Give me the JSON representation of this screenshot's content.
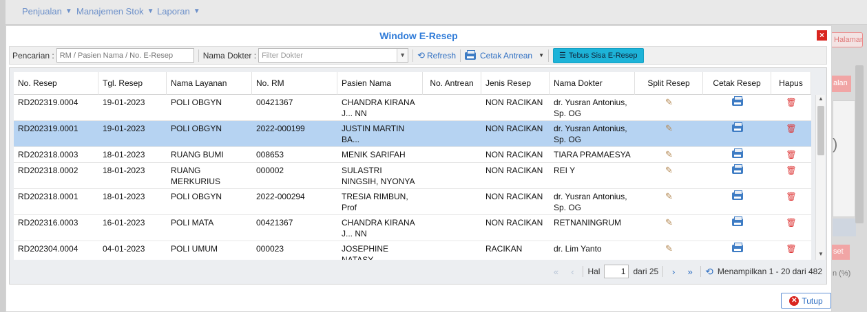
{
  "nav": {
    "items": [
      "Penjualan",
      "Manajemen Stok",
      "Laporan"
    ]
  },
  "background": {
    "halaman_label": "Halaman",
    "btn1_label": "alan",
    "btn2_label": "set",
    "npct_label": "n (%)",
    "paren": ")"
  },
  "modal": {
    "title": "Window E-Resep",
    "close_label": "×",
    "close_button_label": "Tutup"
  },
  "toolbar": {
    "search_label": "Pencarian :",
    "search_placeholder": "RM / Pasien Nama / No. E-Resep",
    "doctor_label": "Nama Dokter :",
    "doctor_placeholder": "Filter Dokter",
    "refresh_label": "Refresh",
    "cetak_antrean_label": "Cetak Antrean",
    "tebus_label": "Tebus Sisa E-Resep"
  },
  "grid": {
    "columns": [
      "No. Resep",
      "Tgl. Resep",
      "Nama Layanan",
      "No. RM",
      "Pasien Nama",
      "No. Antrean",
      "Jenis Resep",
      "Nama Dokter",
      "Split Resep",
      "Cetak Resep",
      "Hapus"
    ],
    "rows": [
      {
        "no_resep": "RD202319.0004",
        "tgl": "19-01-2023",
        "layanan": "POLI OBGYN",
        "rm": "00421367",
        "pasien": "CHANDRA KIRANA J... NN",
        "antrean": "",
        "jenis": "NON RACIKAN",
        "dokter": "dr. Yusran Antonius, Sp. OG",
        "selected": false
      },
      {
        "no_resep": "RD202319.0001",
        "tgl": "19-01-2023",
        "layanan": "POLI OBGYN",
        "rm": "2022-000199",
        "pasien": "JUSTIN MARTIN BA...",
        "antrean": "",
        "jenis": "NON RACIKAN",
        "dokter": "dr. Yusran Antonius, Sp. OG",
        "selected": true
      },
      {
        "no_resep": "RD202318.0003",
        "tgl": "18-01-2023",
        "layanan": "RUANG BUMI",
        "rm": "008653",
        "pasien": "MENIK SARIFAH",
        "antrean": "",
        "jenis": "NON RACIKAN",
        "dokter": "TIARA PRAMAESYA",
        "selected": false
      },
      {
        "no_resep": "RD202318.0002",
        "tgl": "18-01-2023",
        "layanan": "RUANG MERKURIUS",
        "rm": "000002",
        "pasien": "SULASTRI NINGSIH, NYONYA",
        "antrean": "",
        "jenis": "NON RACIKAN",
        "dokter": "REI Y",
        "selected": false
      },
      {
        "no_resep": "RD202318.0001",
        "tgl": "18-01-2023",
        "layanan": "POLI OBGYN",
        "rm": "2022-000294",
        "pasien": "TRESIA RIMBUN, Prof",
        "antrean": "",
        "jenis": "NON RACIKAN",
        "dokter": "dr. Yusran Antonius, Sp. OG",
        "selected": false
      },
      {
        "no_resep": "RD202316.0003",
        "tgl": "16-01-2023",
        "layanan": "POLI MATA",
        "rm": "00421367",
        "pasien": "CHANDRA KIRANA J... NN",
        "antrean": "",
        "jenis": "NON RACIKAN",
        "dokter": "RETNANINGRUM",
        "selected": false
      },
      {
        "no_resep": "RD202304.0004",
        "tgl": "04-01-2023",
        "layanan": "POLI UMUM",
        "rm": "000023",
        "pasien": "JOSEPHINE NATASY...",
        "antrean": "",
        "jenis": "RACIKAN",
        "dokter": "dr. Lim Yanto",
        "selected": false
      }
    ]
  },
  "pager": {
    "hal_label": "Hal",
    "page_value": "1",
    "dari_label": "dari 25",
    "summary": "Menampilkan 1 - 20 dari 482"
  }
}
